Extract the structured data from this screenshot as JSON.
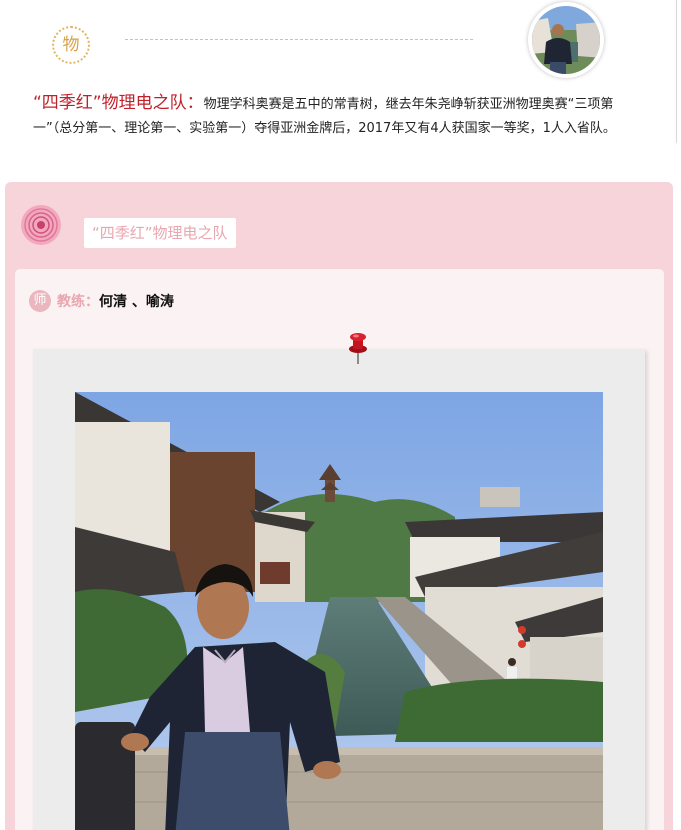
{
  "header": {
    "subject_badge": "物"
  },
  "intro": {
    "lead": "“四季红”物理电之队：",
    "body": "物理学科奥赛是五中的常青树，继去年朱尧峥斩获亚洲物理奥赛“三项第一”（总分第一、理论第一、实验第一）夺得亚洲金牌后，2017年又有4人获国家一等奖，1人入省队。"
  },
  "card": {
    "title": "“四季红”物理电之队",
    "coach_badge": "师",
    "coach_label": "教练：",
    "coach_names": "何清 、喻涛"
  },
  "colors": {
    "lead_red": "#c0202a",
    "card_pink": "#f6d4d9",
    "pill_text": "#e8a7b0",
    "gold": "#e3b45c"
  },
  "icons": {
    "top_badge": "subject-badge-icon",
    "card_badge": "rose-icon",
    "pin": "push-pin-icon",
    "coach": "coach-badge-icon"
  }
}
